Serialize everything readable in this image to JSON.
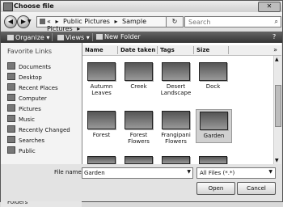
{
  "window": {
    "title": "Choose file",
    "close_glyph": "✕"
  },
  "address": {
    "path": [
      "Public Pictures",
      "Sample Pictures"
    ],
    "sep": "▸",
    "lead": "«"
  },
  "search": {
    "placeholder": "Search"
  },
  "toolbar": {
    "organize": "Organize ▾",
    "views": "Views ▾",
    "new_folder": "New Folder",
    "help": "?"
  },
  "nav": {
    "title": "Favorite Links",
    "items": [
      "Documents",
      "Desktop",
      "Recent Places",
      "Computer",
      "Pictures",
      "Music",
      "Recently Changed",
      "Searches",
      "Public"
    ],
    "folders": "Folders",
    "folders_chevron": "^"
  },
  "columns": [
    "Name",
    "Date taken",
    "Tags",
    "Size"
  ],
  "more": "»",
  "files": [
    {
      "name": "Autumn Leaves",
      "selected": false
    },
    {
      "name": "Creek",
      "selected": false
    },
    {
      "name": "Desert Landscape",
      "selected": false
    },
    {
      "name": "Dock",
      "selected": false
    },
    {
      "name": "Forest",
      "selected": false
    },
    {
      "name": "Forest Flowers",
      "selected": false
    },
    {
      "name": "Frangipani Flowers",
      "selected": false
    },
    {
      "name": "Garden",
      "selected": true
    }
  ],
  "filename": {
    "label": "File name:",
    "value": "Garden"
  },
  "filter": {
    "value": "All Files (*.*)"
  },
  "buttons": {
    "open": "Open",
    "cancel": "Cancel"
  },
  "icons": {
    "back": "◀",
    "forward": "▶",
    "refresh": "↻",
    "search": "⌕",
    "dropdown": "▼"
  }
}
